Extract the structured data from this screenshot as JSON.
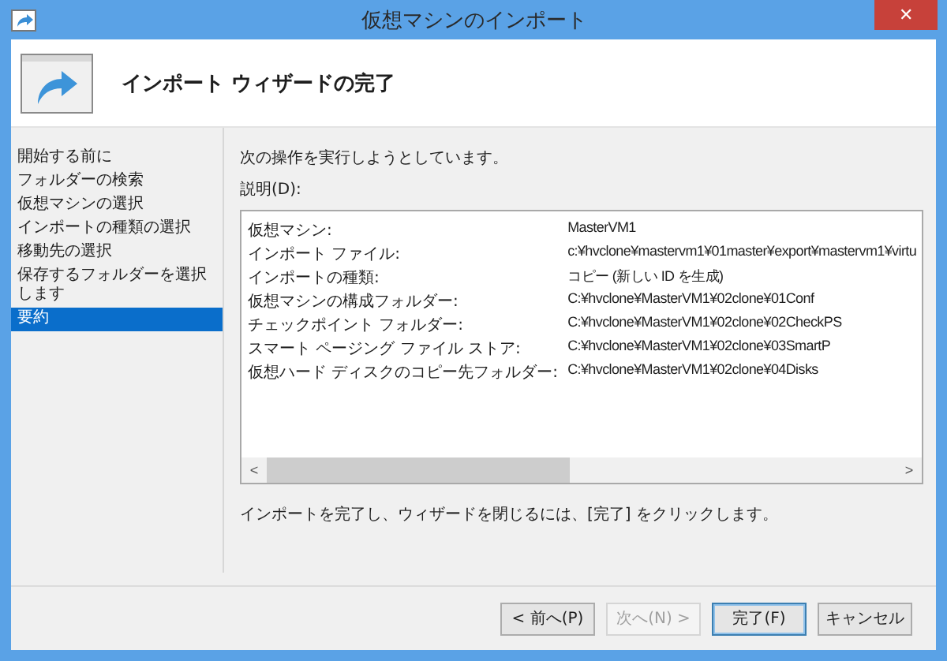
{
  "window": {
    "title": "仮想マシンのインポート",
    "close": "✕"
  },
  "header": {
    "title": "インポート ウィザードの完了"
  },
  "sidebar": {
    "items": [
      {
        "label": "開始する前に",
        "selected": false
      },
      {
        "label": "フォルダーの検索",
        "selected": false
      },
      {
        "label": "仮想マシンの選択",
        "selected": false
      },
      {
        "label": "インポートの種類の選択",
        "selected": false
      },
      {
        "label": "移動先の選択",
        "selected": false
      },
      {
        "label": "保存するフォルダーを選択します",
        "selected": false
      },
      {
        "label": "要約",
        "selected": true
      }
    ]
  },
  "content": {
    "intro": "次の操作を実行しようとしています。",
    "description_label": "説明(D):",
    "rows": [
      {
        "label": "仮想マシン:",
        "value": "MasterVM1"
      },
      {
        "label": "インポート ファイル:",
        "value": "c:¥hvclone¥mastervm1¥01master¥export¥mastervm1¥virtu"
      },
      {
        "label": "インポートの種類:",
        "value": "コピー (新しい ID を生成)"
      },
      {
        "label": "仮想マシンの構成フォルダー:",
        "value": "C:¥hvclone¥MasterVM1¥02clone¥01Conf"
      },
      {
        "label": "チェックポイント フォルダー:",
        "value": "C:¥hvclone¥MasterVM1¥02clone¥02CheckPS"
      },
      {
        "label": "スマート ページング ファイル ストア:",
        "value": "C:¥hvclone¥MasterVM1¥02clone¥03SmartP"
      },
      {
        "label": "仮想ハード ディスクのコピー先フォルダー:",
        "value": "C:¥hvclone¥MasterVM1¥02clone¥04Disks"
      }
    ],
    "scroll_left": "<",
    "scroll_right": ">",
    "footer_note": "インポートを完了し、ウィザードを閉じるには、[完了] をクリックします。"
  },
  "buttons": [
    {
      "label": "< 前へ(P)",
      "disabled": false,
      "default": false
    },
    {
      "label": "次へ(N) >",
      "disabled": true,
      "default": false
    },
    {
      "label": "完了(F)",
      "disabled": false,
      "default": true
    },
    {
      "label": "キャンセル",
      "disabled": false,
      "default": false
    }
  ]
}
